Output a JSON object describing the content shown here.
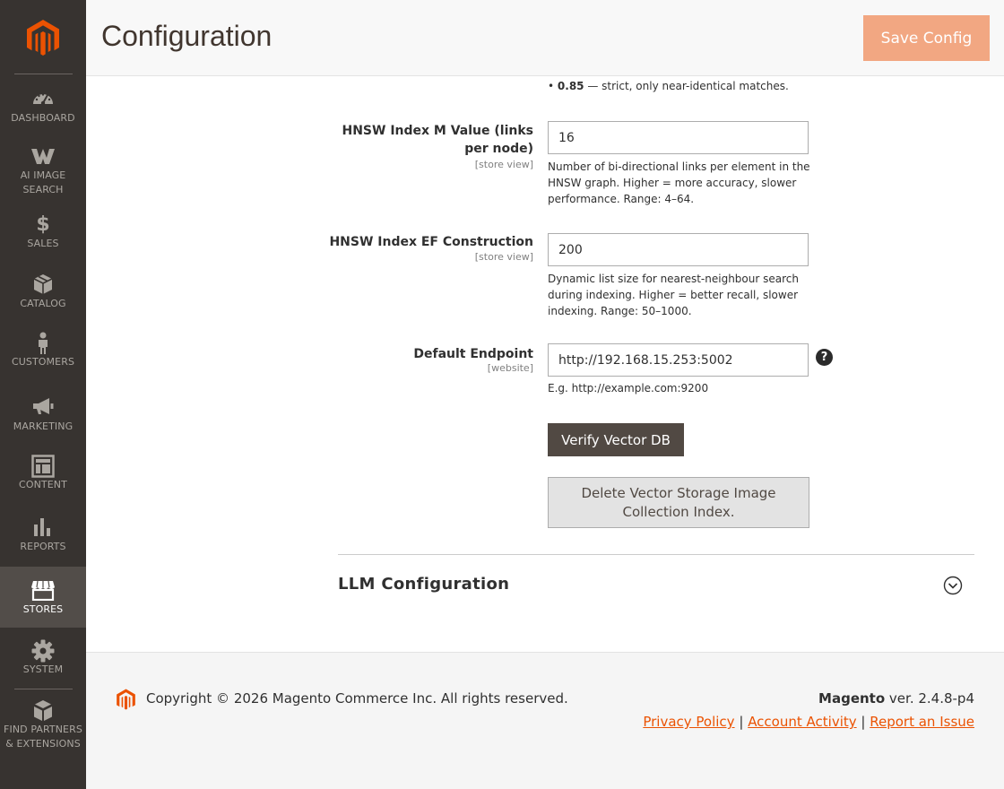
{
  "header": {
    "title": "Configuration",
    "save_label": "Save Config"
  },
  "sidebar": {
    "items": [
      {
        "label": "DASHBOARD",
        "icon": "dashboard-icon"
      },
      {
        "label": "AI IMAGE SEARCH",
        "icon": "ai-image-search-icon"
      },
      {
        "label": "SALES",
        "icon": "dollar-icon"
      },
      {
        "label": "CATALOG",
        "icon": "box-icon"
      },
      {
        "label": "CUSTOMERS",
        "icon": "person-icon"
      },
      {
        "label": "MARKETING",
        "icon": "megaphone-icon"
      },
      {
        "label": "CONTENT",
        "icon": "layout-icon"
      },
      {
        "label": "REPORTS",
        "icon": "bar-chart-icon"
      },
      {
        "label": "STORES",
        "icon": "storefront-icon",
        "active": true
      },
      {
        "label": "SYSTEM",
        "icon": "gear-icon"
      },
      {
        "label": "FIND PARTNERS & EXTENSIONS",
        "icon": "boxes-icon"
      }
    ]
  },
  "form": {
    "top_note_value": "0.85",
    "top_note_text": " — strict, only near-identical matches.",
    "hnsw_m": {
      "label": "HNSW Index M Value (links per node)",
      "scope": "[store view]",
      "value": "16",
      "note": "Number of bi-directional links per element in the HNSW graph. Higher = more accuracy, slower performance. Range: 4–64."
    },
    "hnsw_ef": {
      "label": "HNSW Index EF Construction",
      "scope": "[store view]",
      "value": "200",
      "note": "Dynamic list size for nearest-neighbour search during indexing. Higher = better recall, slower indexing. Range: 50–1000."
    },
    "endpoint": {
      "label": "Default Endpoint",
      "scope": "[website]",
      "value": "http://192.168.15.253:5002",
      "note": "E.g. http://example.com:9200",
      "help": "?"
    },
    "verify_label": "Verify Vector DB",
    "delete_label": "Delete Vector Storage Image Collection Index."
  },
  "section": {
    "title": "LLM Configuration"
  },
  "footer": {
    "copyright": "Copyright © 2026 Magento Commerce Inc. All rights reserved.",
    "brand": "Magento",
    "version": " ver. 2.4.8-p4",
    "links": [
      "Privacy Policy",
      "Account Activity",
      "Report an Issue"
    ],
    "separator": "|"
  },
  "colors": {
    "sidebar_bg": "#373330",
    "accent": "#eb5202",
    "save_button": "#f2a782",
    "verify_button": "#514943"
  }
}
